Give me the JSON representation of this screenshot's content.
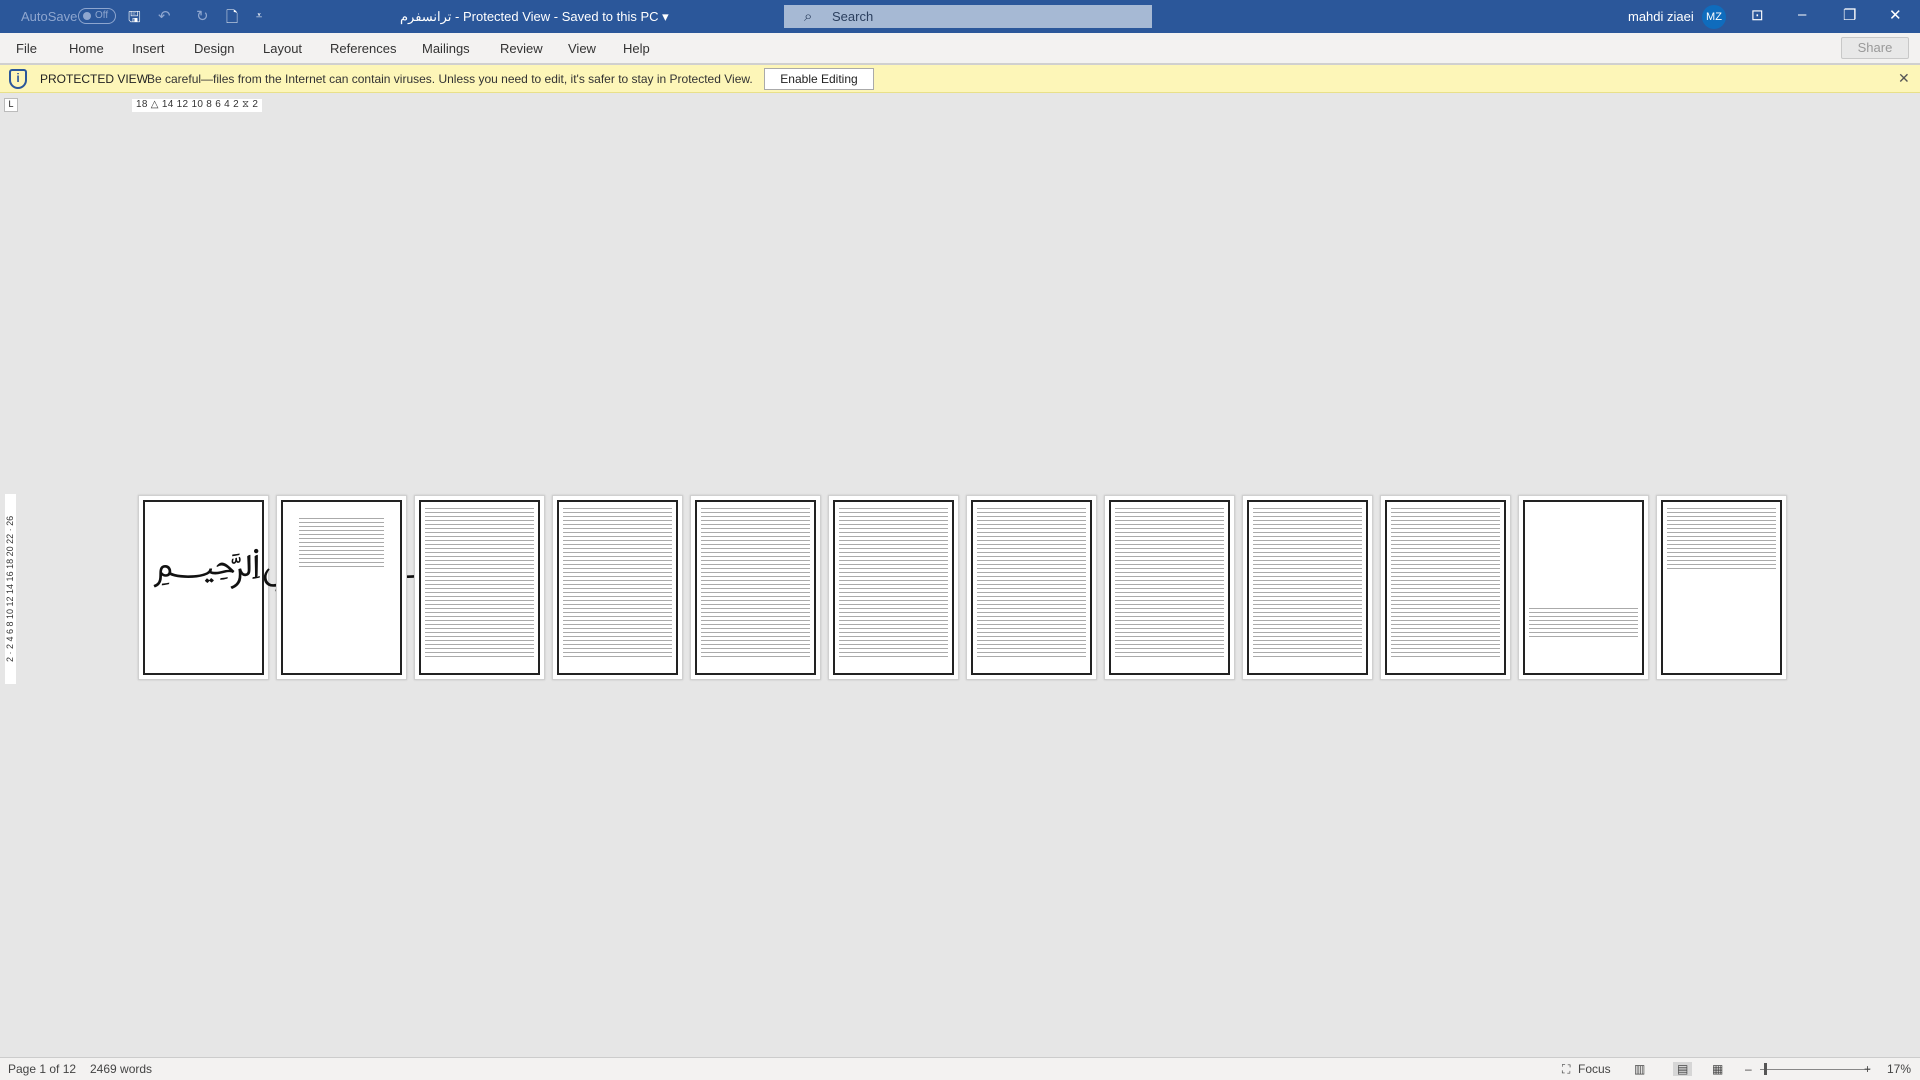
{
  "titlebar": {
    "autosave": "AutoSave",
    "autosave_state": "Off",
    "doc_title": "ترانسفرم  -  Protected View  -  Saved to this PC  ▾",
    "search_placeholder": "Search",
    "user_name": "mahdi ziaei",
    "user_initials": "MZ"
  },
  "menu": {
    "tabs": [
      "File",
      "Home",
      "Insert",
      "Design",
      "Layout",
      "References",
      "Mailings",
      "Review",
      "View",
      "Help"
    ],
    "share": "Share"
  },
  "protected_view": {
    "label": "PROTECTED VIEW",
    "message": "Be careful—files from the Internet can contain viruses. Unless you need to edit, it's safer to stay in Protected View.",
    "enable_button": "Enable Editing"
  },
  "ruler": {
    "horizontal": "18 △ 14 12 10 8 6 4 2 ⧖ 2",
    "vertical": "2 · 2 4 6 8 10 12 14 16 18 20 22 · 26"
  },
  "pages": {
    "count": 12
  },
  "statusbar": {
    "page": "Page 1 of 12",
    "words": "2469 words",
    "focus": "Focus",
    "zoom": "17%",
    "zoom_level": 17
  }
}
